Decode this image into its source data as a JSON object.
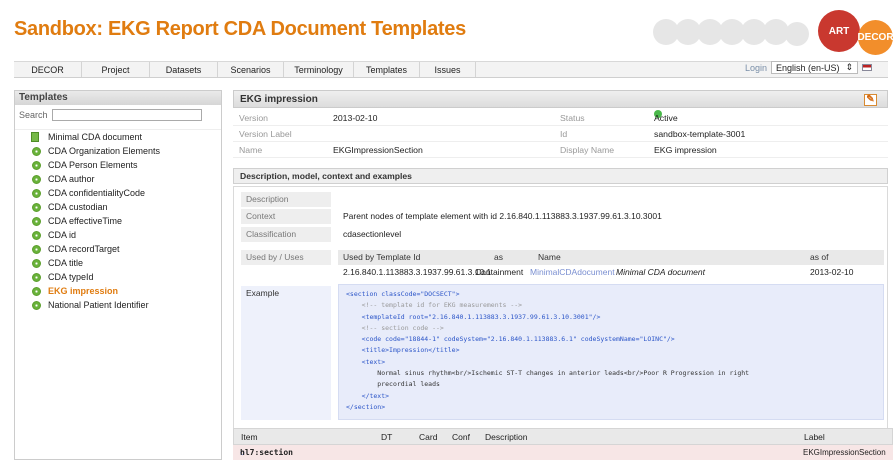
{
  "app": {
    "title": "Sandbox: EKG Report CDA Document Templates"
  },
  "brand": {
    "art": "ART",
    "decor": "DECOR"
  },
  "menu": [
    "DECOR",
    "Project",
    "Datasets",
    "Scenarios",
    "Terminology",
    "Templates",
    "Issues"
  ],
  "topright": {
    "login": "Login",
    "language": "English (en-US)"
  },
  "left": {
    "header": "Templates",
    "search_label": "Search",
    "items": [
      "Minimal CDA document",
      "CDA Organization Elements",
      "CDA Person Elements",
      "CDA author",
      "CDA confidentialityCode",
      "CDA custodian",
      "CDA effectiveTime",
      "CDA id",
      "CDA recordTarget",
      "CDA title",
      "CDA typeId",
      "EKG impression",
      "National Patient Identifier"
    ]
  },
  "panel": {
    "title": "EKG impression",
    "version_label": "Version",
    "version": "2013-02-10",
    "version_label_label": "Version Label",
    "name_label": "Name",
    "name": "EKGImpressionSection",
    "status_label": "Status",
    "status": "Active",
    "id_label": "Id",
    "id": "sandbox-template-3001",
    "display_name_label": "Display Name",
    "display_name": "EKG impression"
  },
  "details": {
    "header": "Description, model, context and examples",
    "description_label": "Description",
    "context_label": "Context",
    "context": "Parent nodes of template element with id 2.16.840.1.113883.3.1937.99.61.3.10.3001",
    "classification_label": "Classification",
    "classification": "cdasectionlevel",
    "usedby_label": "Used by / Uses",
    "usedby_headers": [
      "Used by Template Id",
      "as",
      "Name",
      "as of"
    ],
    "usedby_row": {
      "id": "2.16.840.1.113883.3.1937.99.61.3.10.1",
      "as": "Containment",
      "name_link": "MinimalCDAdocument",
      "name_display": "Minimal CDA document",
      "asof": "2013-02-10"
    },
    "example_label": "Example",
    "code_lines": [
      "<section classCode=\"DOCSECT\">",
      "    <!-- template id for EKG measurements -->",
      "    <templateId root=\"2.16.840.1.113883.3.1937.99.61.3.10.3001\"/>",
      "    <!-- section code -->",
      "    <code code=\"18844-1\" codeSystem=\"2.16.840.1.113883.6.1\" codeSystemName=\"LOINC\"/>",
      "    <title>Impression</title>",
      "    <text>",
      "        Normal sinus rhythm<br/>Ischemic ST-T changes in anterior leads<br/>Poor R Progression in right",
      "        precordial leads",
      "    </text>",
      "</section>"
    ]
  },
  "bottom": {
    "headers": [
      "Item",
      "DT",
      "Card",
      "Conf",
      "Description",
      "Label"
    ],
    "row": {
      "item": "hl7:section",
      "label": "EKGImpressionSection"
    }
  }
}
